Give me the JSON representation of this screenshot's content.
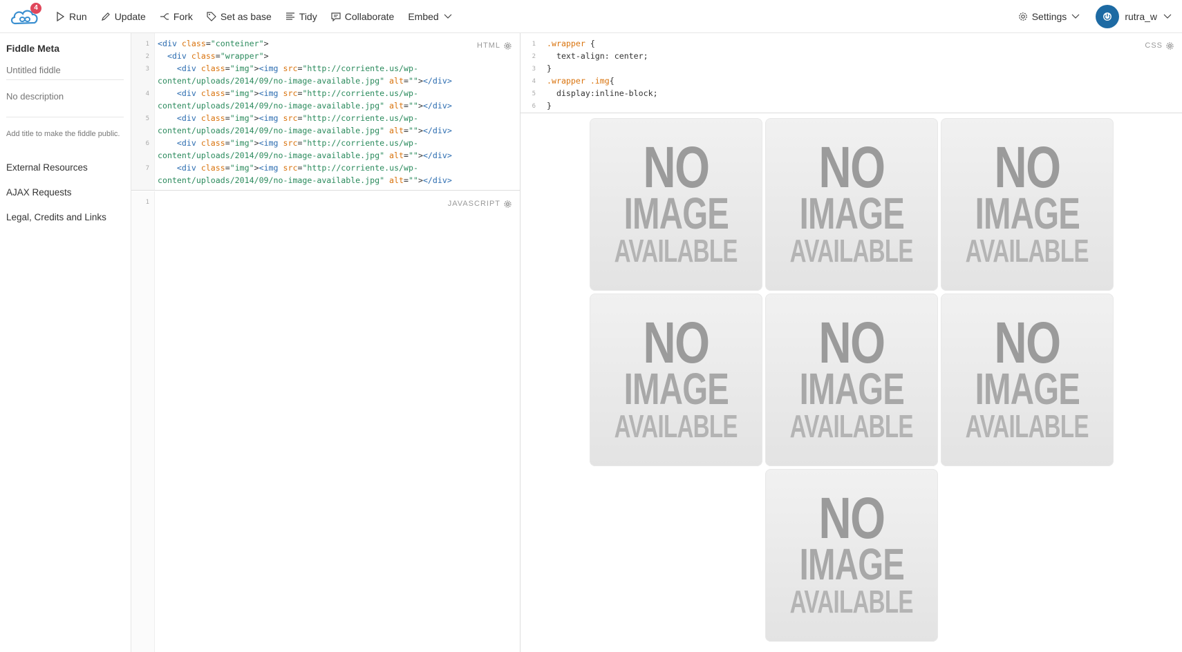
{
  "topbar": {
    "notification_count": "4",
    "run_label": "Run",
    "update_label": "Update",
    "fork_label": "Fork",
    "set_base_label": "Set as base",
    "tidy_label": "Tidy",
    "collaborate_label": "Collaborate",
    "embed_label": "Embed",
    "settings_label": "Settings",
    "username": "rutra_w"
  },
  "sidebar": {
    "title": "Fiddle Meta",
    "name_placeholder": "Untitled fiddle",
    "desc_placeholder": "No description",
    "hint": "Add title to make the fiddle public.",
    "links": [
      "External Resources",
      "AJAX Requests",
      "Legal, Credits and Links"
    ]
  },
  "editors": {
    "html_label": "HTML",
    "js_label": "JAVASCRIPT",
    "css_label": "CSS",
    "html_code": {
      "l1_open": "<div",
      "l1_attr": "class",
      "l1_val": "\"conteiner\"",
      "l2_open": "<div",
      "l2_attr": "class",
      "l2_val": "\"wrapper\"",
      "div_open": "<div",
      "class_attr": "class",
      "img_val": "\"img\"",
      "img_open": "<img",
      "src_attr": "src",
      "src_part1": "\"http://corriente.us/wp-",
      "src_part2": "content/uploads/2014/09/no-image-available.jpg\"",
      "alt_attr": "alt",
      "alt_val": "\"\"",
      "div_close": "</div>"
    },
    "css_code": {
      "sel1": ".wrapper",
      "prop1": "text-align: center;",
      "sel2": ".wrapper .img",
      "prop2": "display:inline-block;"
    }
  },
  "result": {
    "placeholder_text": [
      "NO",
      "IMAGE",
      "AVAILABLE"
    ]
  },
  "colors": {
    "accent": "#1d6aa3",
    "badge": "#e0475b"
  }
}
